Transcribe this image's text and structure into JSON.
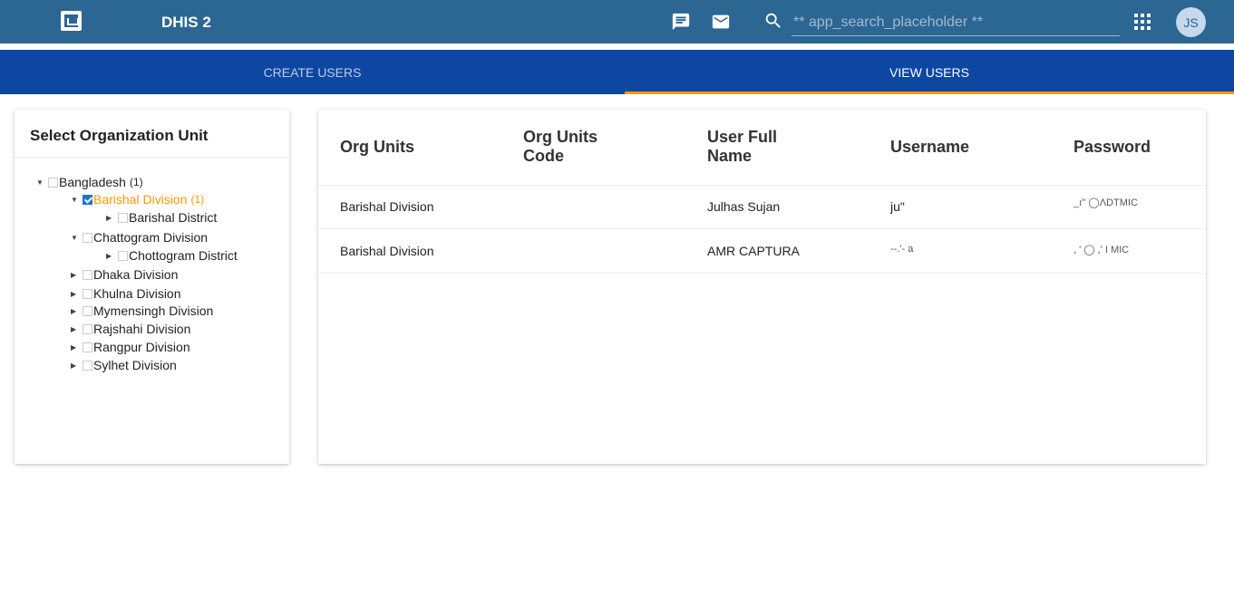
{
  "header": {
    "app_title": "DHIS 2",
    "search_placeholder": "** app_search_placeholder **",
    "avatar_initials": "JS",
    "brand_color": "#2c6693"
  },
  "tabs": [
    {
      "label": "CREATE USERS",
      "active": false
    },
    {
      "label": "VIEW USERS",
      "active": true
    }
  ],
  "accent_color": "#ff9800",
  "org_tree": {
    "title": "Select Organization Unit",
    "nodes": [
      {
        "label": "Bangladesh",
        "count": "(1)",
        "checked": false,
        "expanded": true
      },
      {
        "label": "Barishal Division",
        "count": "(1)",
        "checked": true,
        "expanded": true,
        "selected": true
      },
      {
        "label": "Barishal District",
        "checked": false,
        "expanded": false
      },
      {
        "label": "Chattogram Division",
        "checked": false,
        "expanded": true
      },
      {
        "label": "Chottogram District",
        "checked": false,
        "expanded": false
      },
      {
        "label": "Dhaka Division",
        "checked": false,
        "expanded": false
      },
      {
        "label": "Khulna Division",
        "checked": false,
        "expanded": false
      },
      {
        "label": "Mymensingh Division",
        "checked": false,
        "expanded": false
      },
      {
        "label": "Rajshahi Division",
        "checked": false,
        "expanded": false
      },
      {
        "label": "Rangpur Division",
        "checked": false,
        "expanded": false
      },
      {
        "label": "Sylhet Division",
        "checked": false,
        "expanded": false
      }
    ]
  },
  "users_table": {
    "columns": [
      "Org Units",
      "Org Units Code",
      "User Full Name",
      "Username",
      "Password"
    ],
    "rows": [
      {
        "org_unit": "Barishal Division",
        "org_code": "",
        "full_name": "Julhas Sujan",
        "username": "ju\"",
        "password": "_ı'' ◯ΛDTMIC"
      },
      {
        "org_unit": "Barishal Division",
        "org_code": "",
        "full_name": "AMR CAPTURA",
        "username": "--.'- a",
        "password": ", ' ◯ ,' I MIC"
      }
    ]
  }
}
